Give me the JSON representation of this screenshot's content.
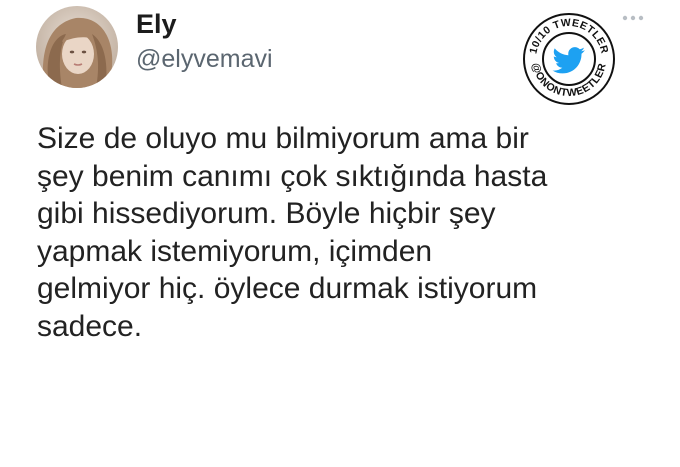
{
  "user": {
    "display_name": "Ely",
    "handle": "@elyvemavi"
  },
  "stamp": {
    "text_top": "10/10 TWEETLER",
    "text_bottom": "@ONONTWEETLER",
    "icon": "twitter-bird-icon"
  },
  "menu": {
    "icon": "more-dots-icon"
  },
  "tweet": {
    "lines": [
      "Size de oluyo mu bilmiyorum ama bir",
      "şey benim canımı çok sıktığında hasta",
      "gibi hissediyorum. Böyle hiçbir şey",
      "yapmak istemiyorum, içimden",
      "gelmiyor hiç. öylece durmak istiyorum",
      "sadece."
    ]
  },
  "colors": {
    "text": "#222222",
    "handle": "#5b6670",
    "twitter_blue": "#1da1f2",
    "stamp_ring": "#111111"
  }
}
